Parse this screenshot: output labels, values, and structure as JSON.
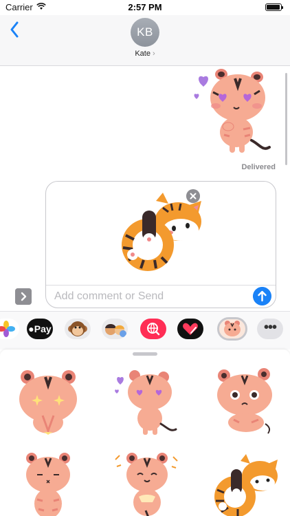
{
  "status_bar": {
    "carrier": "Carrier",
    "time": "2:57 PM"
  },
  "header": {
    "avatar_initials": "KB",
    "contact_name": "Kate",
    "contact_chevron": "›"
  },
  "thread": {
    "status": "Delivered"
  },
  "compose": {
    "placeholder": "Add comment or Send"
  },
  "app_drawer": {
    "apps": [
      {
        "name": "photos"
      },
      {
        "name": "apple-pay",
        "label": "Pay"
      },
      {
        "name": "animoji"
      },
      {
        "name": "memoji"
      },
      {
        "name": "image-search"
      },
      {
        "name": "digital-touch"
      },
      {
        "name": "tiger-stickers"
      },
      {
        "name": "more",
        "label": "•••"
      }
    ]
  },
  "colors": {
    "accent": "#1a82f7",
    "tiger_pink_body": "#f6ab93",
    "tiger_pink_dark": "#e98476",
    "tiger_orange": "#f39a2e",
    "heart_purple": "#a97be0",
    "stripe": "#3a2a2a"
  },
  "icons": {
    "back": "chevron-left-icon",
    "send": "arrow-up-icon",
    "remove": "close-icon",
    "expand": "chevron-right-icon",
    "photos": "flower-icon",
    "search": "globe-search-icon",
    "heart": "heart-icon"
  }
}
